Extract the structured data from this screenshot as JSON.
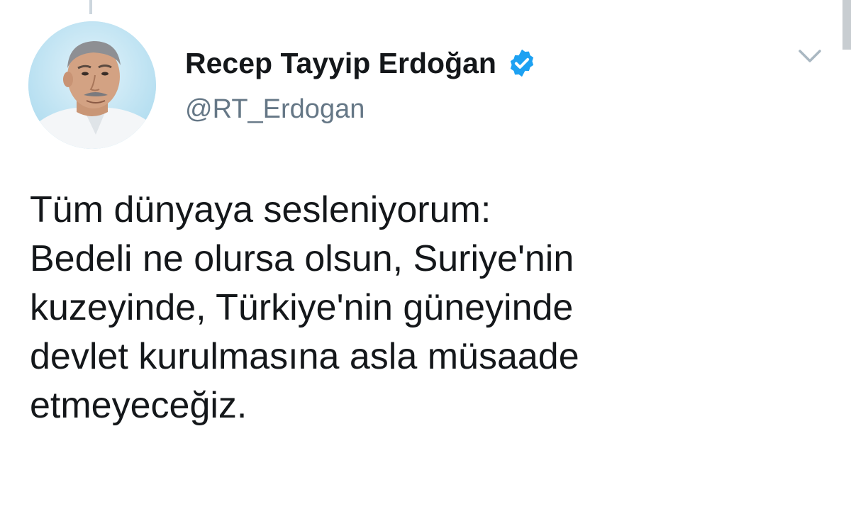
{
  "tweet": {
    "author": {
      "display_name": "Recep Tayyip Erdoğan",
      "handle": "@RT_Erdogan",
      "verified": true
    },
    "text": "Tüm dünyaya sesleniyorum:\nBedeli ne olursa olsun, Suriye'nin\nkuzeyinde, Türkiye'nin güneyinde\ndevlet kurulmasına asla müsaade\netmeyeceğiz.",
    "icons": {
      "verified": "verified-badge-icon",
      "menu": "chevron-down-icon"
    }
  },
  "colors": {
    "name_text": "#14171a",
    "handle_text": "#657786",
    "verified_badge": "#1da1f2",
    "caret": "#aab8c2",
    "thread_line": "#ccd6dd",
    "avatar_background": "#c7e6f3"
  }
}
